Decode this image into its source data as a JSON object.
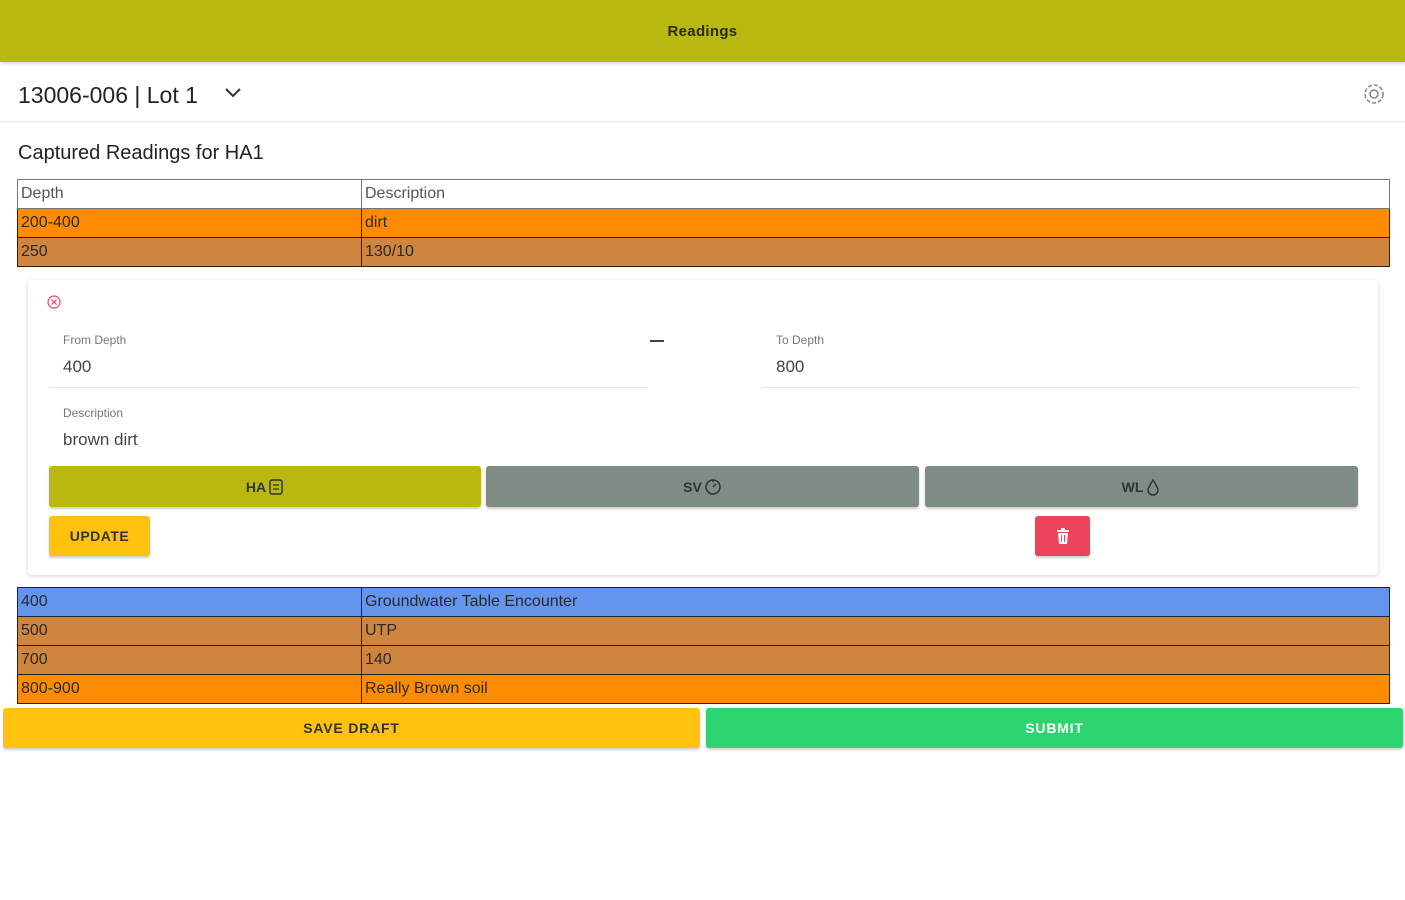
{
  "header": {
    "title": "Readings"
  },
  "project": {
    "title": "13006-006 | Lot 1"
  },
  "section": {
    "title": "Captured Readings for HA1"
  },
  "table_top": {
    "headers": {
      "depth": "Depth",
      "description": "Description"
    },
    "rows": [
      {
        "depth": "200-400",
        "description": "dirt",
        "color": "#ff8c00"
      },
      {
        "depth": "250",
        "description": "130/10",
        "color": "#cd853f"
      }
    ]
  },
  "form": {
    "from_depth": {
      "label": "From Depth",
      "value": "400"
    },
    "to_depth": {
      "label": "To Depth",
      "value": "800"
    },
    "description": {
      "label": "Description",
      "value": "brown dirt"
    },
    "types": {
      "ha": "HA",
      "sv": "SV",
      "wl": "WL"
    },
    "update_label": "UPDATE"
  },
  "table_bottom": {
    "rows": [
      {
        "depth": "400",
        "description": "Groundwater Table Encounter",
        "color": "#6495ed"
      },
      {
        "depth": "500",
        "description": "UTP",
        "color": "#cd853f"
      },
      {
        "depth": "700",
        "description": "140",
        "color": "#cd853f"
      },
      {
        "depth": "800-900",
        "description": "Really Brown soil",
        "color": "#ff8c00"
      }
    ]
  },
  "footer": {
    "save_label": "SAVE DRAFT",
    "submit_label": "SUBMIT"
  },
  "colors": {
    "accent": "#b8b810",
    "warning": "#ffc20e",
    "success": "#2dd36f",
    "danger": "#eb445a",
    "medium": "#7e8c84"
  },
  "icons": [
    "chevron-down-icon",
    "settings-icon",
    "close-circle-icon",
    "ha-icon",
    "sv-timer-icon",
    "wl-water-icon",
    "trash-icon"
  ]
}
